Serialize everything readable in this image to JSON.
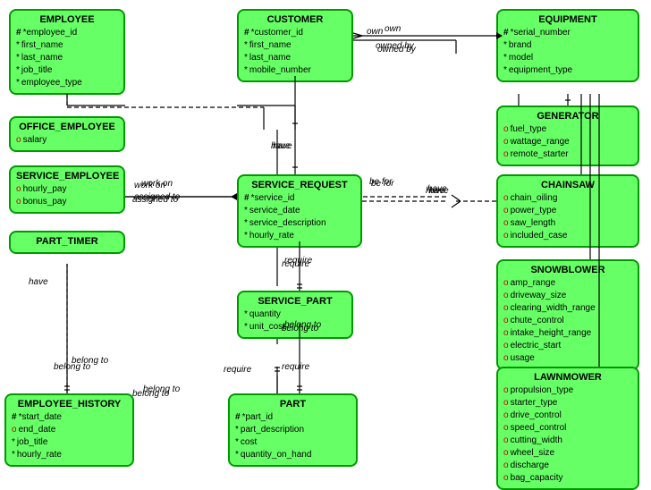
{
  "entities": {
    "employee": {
      "title": "EMPLOYEE",
      "attrs": [
        {
          "sym": "#",
          "type": "hash",
          "text": "employee_id"
        },
        {
          "sym": "*",
          "type": "star",
          "text": "first_name"
        },
        {
          "sym": "*",
          "type": "star",
          "text": "last_name"
        },
        {
          "sym": "*",
          "type": "star",
          "text": "job_title"
        },
        {
          "sym": "*",
          "type": "star",
          "text": "employee_type"
        }
      ]
    },
    "office_employee": {
      "title": "OFFICE_EMPLOYEE",
      "attrs": [
        {
          "sym": "o",
          "type": "circle",
          "text": "salary"
        }
      ]
    },
    "service_employee": {
      "title": "SERVICE_EMPLOYEE",
      "attrs": [
        {
          "sym": "o",
          "type": "circle",
          "text": "hourly_pay"
        },
        {
          "sym": "o",
          "type": "circle",
          "text": "bonus_pay"
        }
      ]
    },
    "part_timer": {
      "title": "PART_TIMER",
      "attrs": []
    },
    "customer": {
      "title": "CUSTOMER",
      "attrs": [
        {
          "sym": "#",
          "type": "hash",
          "text": "customer_id"
        },
        {
          "sym": "*",
          "type": "star",
          "text": "first_name"
        },
        {
          "sym": "*",
          "type": "star",
          "text": "last_name"
        },
        {
          "sym": "*",
          "type": "star",
          "text": "mobile_number"
        }
      ]
    },
    "service_request": {
      "title": "SERVICE_REQUEST",
      "attrs": [
        {
          "sym": "#",
          "type": "hash",
          "text": "service_id"
        },
        {
          "sym": "*",
          "type": "star",
          "text": "service_date"
        },
        {
          "sym": "*",
          "type": "star",
          "text": "service_description"
        },
        {
          "sym": "*",
          "type": "star",
          "text": "hourly_rate"
        }
      ]
    },
    "service_part": {
      "title": "SERVICE_PART",
      "attrs": [
        {
          "sym": "*",
          "type": "star",
          "text": "quantity"
        },
        {
          "sym": "*",
          "type": "star",
          "text": "unit_cost"
        }
      ]
    },
    "part": {
      "title": "PART",
      "attrs": [
        {
          "sym": "#",
          "type": "hash",
          "text": "part_id"
        },
        {
          "sym": "*",
          "type": "star",
          "text": "part_description"
        },
        {
          "sym": "*",
          "type": "star",
          "text": "cost"
        },
        {
          "sym": "*",
          "type": "star",
          "text": "quantity_on_hand"
        }
      ]
    },
    "employee_history": {
      "title": "EMPLOYEE_HISTORY",
      "attrs": [
        {
          "sym": "#",
          "type": "hash",
          "text": "start_date"
        },
        {
          "sym": "o",
          "type": "circle",
          "text": "end_date"
        },
        {
          "sym": "*",
          "type": "star",
          "text": "job_title"
        },
        {
          "sym": "*",
          "type": "star",
          "text": "hourly_rate"
        }
      ]
    },
    "equipment": {
      "title": "EQUIPMENT",
      "attrs": [
        {
          "sym": "#",
          "type": "hash",
          "text": "serial_number"
        },
        {
          "sym": "*",
          "type": "star",
          "text": "brand"
        },
        {
          "sym": "*",
          "type": "star",
          "text": "model"
        },
        {
          "sym": "*",
          "type": "star",
          "text": "equipment_type"
        }
      ]
    },
    "generator": {
      "title": "GENERATOR",
      "attrs": [
        {
          "sym": "o",
          "type": "circle",
          "text": "fuel_type"
        },
        {
          "sym": "o",
          "type": "circle",
          "text": "wattage_range"
        },
        {
          "sym": "o",
          "type": "circle",
          "text": "remote_starter"
        }
      ]
    },
    "chainsaw": {
      "title": "CHAINSAW",
      "attrs": [
        {
          "sym": "o",
          "type": "circle",
          "text": "chain_oiling"
        },
        {
          "sym": "o",
          "type": "circle",
          "text": "power_type"
        },
        {
          "sym": "o",
          "type": "circle",
          "text": "saw_length"
        },
        {
          "sym": "o",
          "type": "circle",
          "text": "included_case"
        }
      ]
    },
    "snowblower": {
      "title": "SNOWBLOWER",
      "attrs": [
        {
          "sym": "o",
          "type": "circle",
          "text": "amp_range"
        },
        {
          "sym": "o",
          "type": "circle",
          "text": "driveway_size"
        },
        {
          "sym": "o",
          "type": "circle",
          "text": "clearing_width_range"
        },
        {
          "sym": "o",
          "type": "circle",
          "text": "chute_control"
        },
        {
          "sym": "o",
          "type": "circle",
          "text": "intake_height_range"
        },
        {
          "sym": "o",
          "type": "circle",
          "text": "electric_start"
        },
        {
          "sym": "o",
          "type": "circle",
          "text": "usage"
        }
      ]
    },
    "lawnmower": {
      "title": "LAWNMOWER",
      "attrs": [
        {
          "sym": "o",
          "type": "circle",
          "text": "propulsion_type"
        },
        {
          "sym": "o",
          "type": "circle",
          "text": "starter_type"
        },
        {
          "sym": "o",
          "type": "circle",
          "text": "drive_control"
        },
        {
          "sym": "o",
          "type": "circle",
          "text": "speed_control"
        },
        {
          "sym": "o",
          "type": "circle",
          "text": "cutting_width"
        },
        {
          "sym": "o",
          "type": "circle",
          "text": "wheel_size"
        },
        {
          "sym": "o",
          "type": "circle",
          "text": "discharge"
        },
        {
          "sym": "o",
          "type": "circle",
          "text": "bag_capacity"
        }
      ]
    }
  },
  "relations": {
    "have1": "have",
    "belong_to1": "belong to",
    "work_on": "work on",
    "assigned_to": "assigned to",
    "have2": "have",
    "be_for": "be for",
    "own": "own",
    "owned_by": "owned by",
    "require1": "require",
    "belong_to2": "belong to",
    "require2": "require",
    "belong_to3": "belong to",
    "belong_to4": "belong to"
  }
}
